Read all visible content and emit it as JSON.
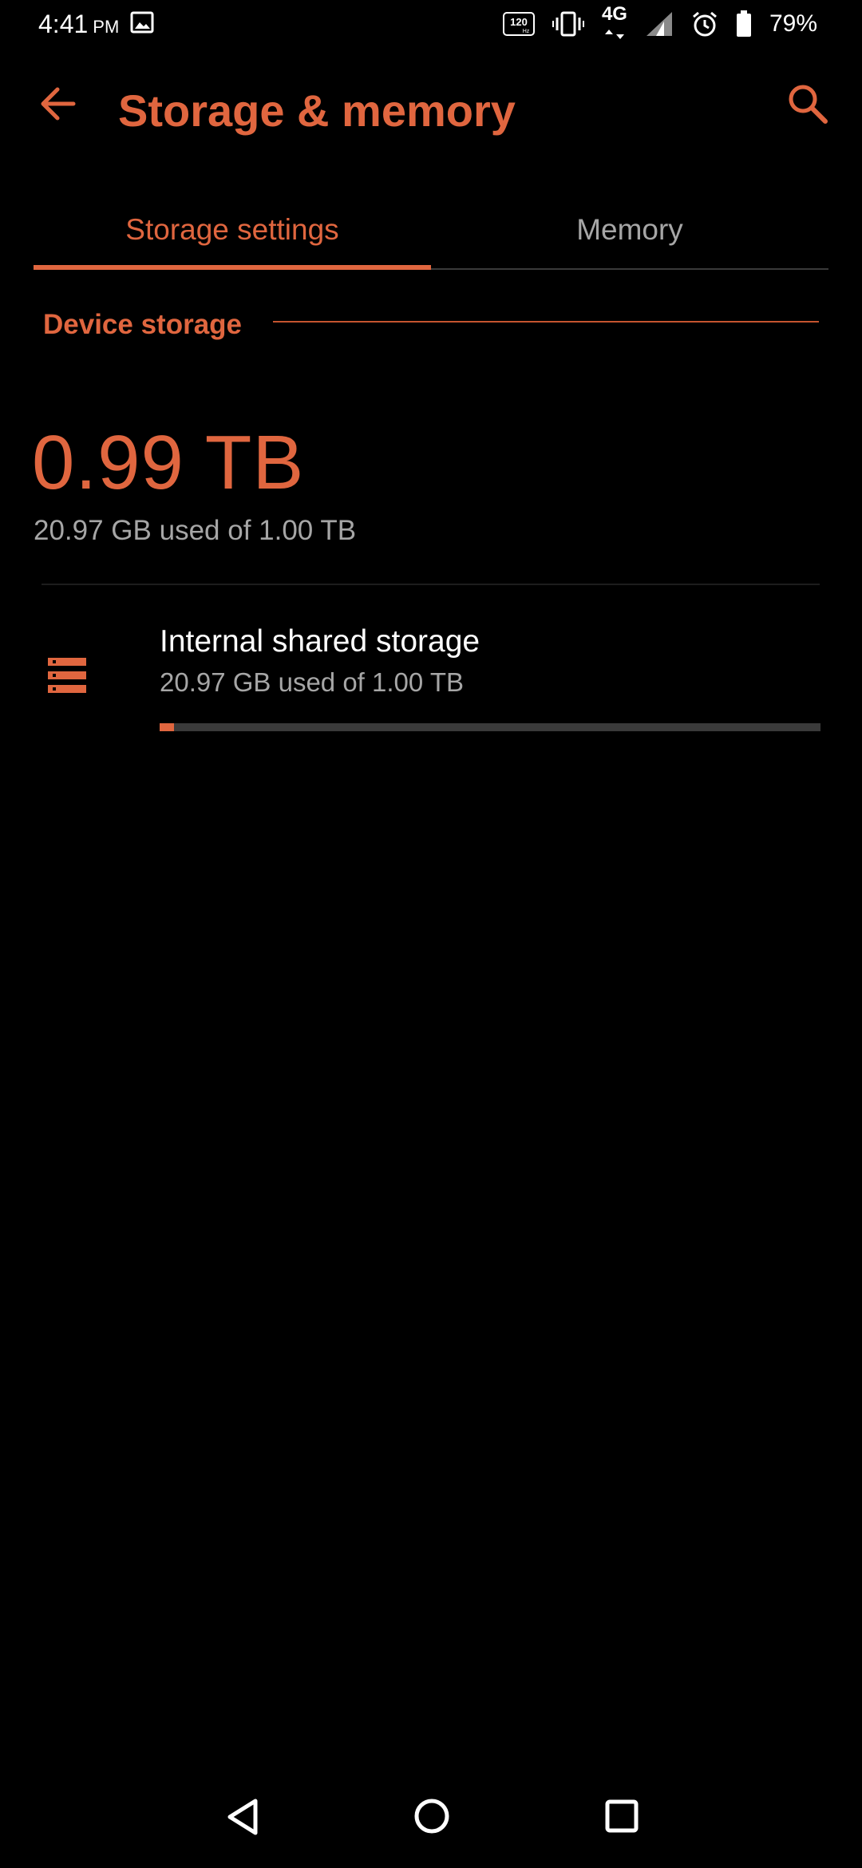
{
  "status_bar": {
    "time": "4:41",
    "ampm": "PM",
    "refresh_rate": "120",
    "refresh_unit": "Hz",
    "network": "4G",
    "battery_percent": "79%"
  },
  "toolbar": {
    "title": "Storage & memory",
    "back_icon": "arrow-left-icon",
    "search_icon": "search-icon"
  },
  "tabs": [
    {
      "label": "Storage settings",
      "selected": true
    },
    {
      "label": "Memory",
      "selected": false
    }
  ],
  "section": {
    "header": "Device storage"
  },
  "device_storage": {
    "free_value": "0.99 TB",
    "used_summary": "20.97 GB used of 1.00 TB"
  },
  "storage_items": [
    {
      "name": "Internal shared storage",
      "used": "20.97 GB used of 1.00 TB",
      "used_fraction": 0.021,
      "icon": "storage-icon"
    }
  ],
  "colors": {
    "accent": "#e0663f",
    "background": "#000000",
    "secondary_text": "#a6a6a6"
  }
}
